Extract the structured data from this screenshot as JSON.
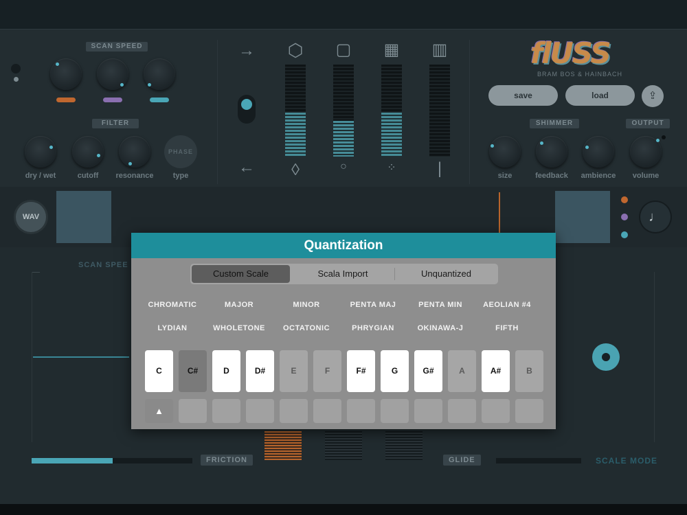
{
  "top_panel": {
    "scan_speed_label": "SCAN SPEED",
    "filter_label": "FILTER",
    "phase_label": "PHASE",
    "shimmer_label": "SHIMMER",
    "output_label": "OUTPUT",
    "filter_knobs": [
      "dry / wet",
      "cutoff",
      "resonance",
      "type"
    ],
    "fx_knobs": [
      "size",
      "feedback",
      "ambience",
      "volume"
    ],
    "save_label": "save",
    "load_label": "load",
    "logo_text": "flUSS",
    "logo_sub": "BRAM BOS & HAINBACH",
    "colors": {
      "orange": "#c0672f",
      "purple": "#8a6fb0",
      "teal": "#4aa6b6"
    }
  },
  "mid_strip": {
    "wav_label": "WAV",
    "note_icon": "♩"
  },
  "lower": {
    "scan_speed_faded": "SCAN SPEE",
    "friction_label": "FRICTION",
    "glide_label": "GLIDE",
    "scale_mode_label": "SCALE MODE"
  },
  "modal": {
    "title": "Quantization",
    "tabs": [
      "Custom Scale",
      "Scala Import",
      "Unquantized"
    ],
    "active_tab": "Custom Scale",
    "scales_row1": [
      "CHROMATIC",
      "MAJOR",
      "MINOR",
      "PENTA MAJ",
      "PENTA MIN",
      "AEOLIAN #4"
    ],
    "scales_row2": [
      "LYDIAN",
      "WHOLETONE",
      "OCTATONIC",
      "PHRYGIAN",
      "OKINAWA-J",
      "FIFTH"
    ],
    "keys": [
      {
        "note": "C",
        "state": "on"
      },
      {
        "note": "C#",
        "state": "root"
      },
      {
        "note": "D",
        "state": "on"
      },
      {
        "note": "D#",
        "state": "on"
      },
      {
        "note": "E",
        "state": "off"
      },
      {
        "note": "F",
        "state": "off"
      },
      {
        "note": "F#",
        "state": "on"
      },
      {
        "note": "G",
        "state": "on"
      },
      {
        "note": "G#",
        "state": "on"
      },
      {
        "note": "A",
        "state": "off"
      },
      {
        "note": "A#",
        "state": "on"
      },
      {
        "note": "B",
        "state": "off"
      }
    ],
    "root_marker": "▲",
    "accent_color": "#1e8e9b"
  }
}
